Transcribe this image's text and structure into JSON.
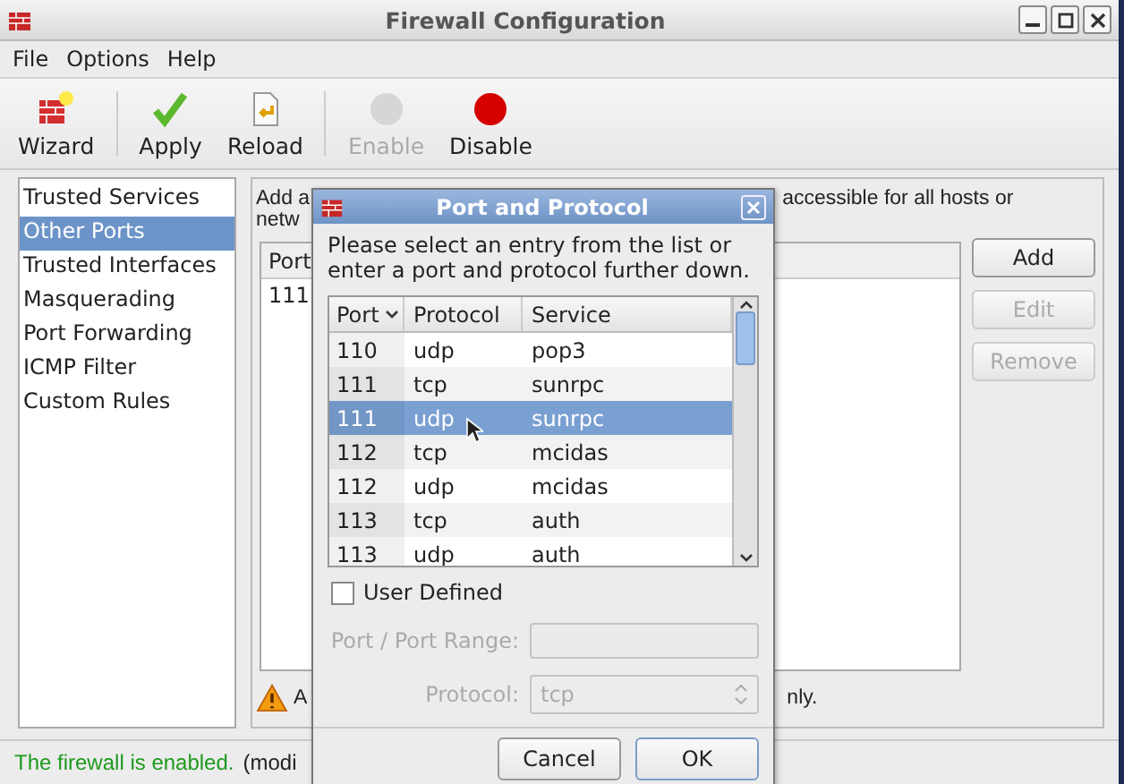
{
  "window": {
    "title": "Firewall Configuration"
  },
  "menu": [
    "File",
    "Options",
    "Help"
  ],
  "toolbar": [
    {
      "label": "Wizard",
      "kind": "wizard",
      "disabled": false
    },
    {
      "label": "Apply",
      "kind": "apply",
      "disabled": false
    },
    {
      "label": "Reload",
      "kind": "reload",
      "disabled": false
    },
    {
      "label": "Enable",
      "kind": "enable",
      "disabled": true
    },
    {
      "label": "Disable",
      "kind": "disable",
      "disabled": false
    }
  ],
  "sidebar": [
    {
      "label": "Trusted Services",
      "selected": false
    },
    {
      "label": "Other Ports",
      "selected": true
    },
    {
      "label": "Trusted Interfaces",
      "selected": false
    },
    {
      "label": "Masquerading",
      "selected": false
    },
    {
      "label": "Port Forwarding",
      "selected": false
    },
    {
      "label": "ICMP Filter",
      "selected": false
    },
    {
      "label": "Custom Rules",
      "selected": false
    }
  ],
  "panel": {
    "intro_start": "Add a",
    "intro_end": "accessible for all hosts or",
    "intro_line2": "netw",
    "column_1": "Port",
    "rows": [
      "111"
    ],
    "buttons": [
      {
        "label": "Add",
        "disabled": false
      },
      {
        "label": "Edit",
        "disabled": true
      },
      {
        "label": "Remove",
        "disabled": true
      }
    ],
    "note_start": "A",
    "note_end": "nly."
  },
  "status_bar": {
    "state": "The firewall is enabled.",
    "note": "(modi"
  },
  "dialog": {
    "title": "Port and Protocol",
    "message": "Please select an entry from the list or enter a port and protocol further down.",
    "columns": [
      {
        "label": "Port",
        "sorted": true
      },
      {
        "label": "Protocol",
        "sorted": false
      },
      {
        "label": "Service",
        "sorted": false
      }
    ],
    "rows": [
      {
        "port": "110",
        "protocol": "udp",
        "service": "pop3",
        "selected": false
      },
      {
        "port": "111",
        "protocol": "tcp",
        "service": "sunrpc",
        "selected": false
      },
      {
        "port": "111",
        "protocol": "udp",
        "service": "sunrpc",
        "selected": true
      },
      {
        "port": "112",
        "protocol": "tcp",
        "service": "mcidas",
        "selected": false
      },
      {
        "port": "112",
        "protocol": "udp",
        "service": "mcidas",
        "selected": false
      },
      {
        "port": "113",
        "protocol": "tcp",
        "service": "auth",
        "selected": false
      },
      {
        "port": "113",
        "protocol": "udp",
        "service": "auth",
        "selected": false
      }
    ],
    "user_defined": {
      "label": "User Defined",
      "checked": false
    },
    "port_range": {
      "label": "Port / Port Range:",
      "disabled": true
    },
    "protocol": {
      "label": "Protocol:",
      "value": "tcp",
      "disabled": true
    },
    "buttons": [
      {
        "label": "Cancel",
        "default": false
      },
      {
        "label": "OK",
        "default": true
      }
    ]
  }
}
